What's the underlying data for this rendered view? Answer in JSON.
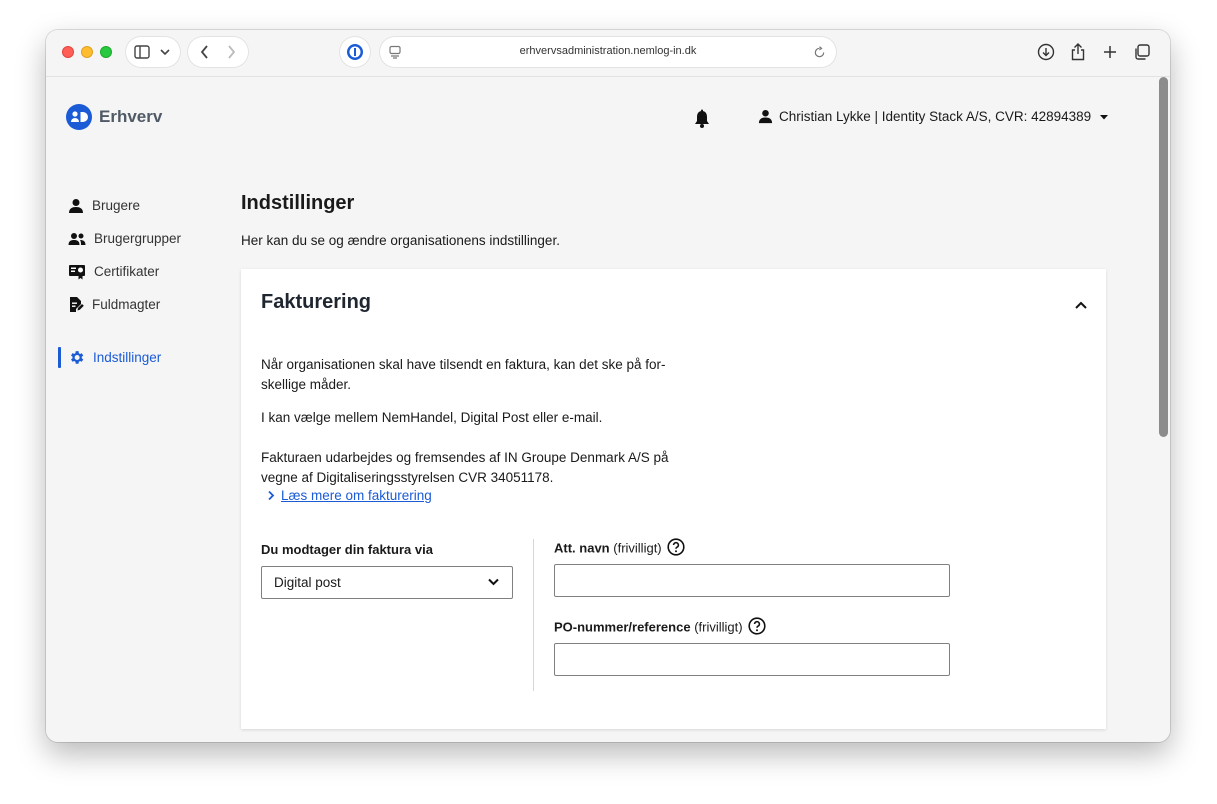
{
  "browser": {
    "url": "erhvervsadministration.nemlog-in.dk"
  },
  "brand": {
    "name": "Erhverv"
  },
  "header": {
    "user_label": "Christian Lykke | Identity Stack A/S, CVR: 42894389"
  },
  "sidebar": {
    "items": [
      {
        "label": "Brugere",
        "icon": "person-icon"
      },
      {
        "label": "Brugergrupper",
        "icon": "people-icon"
      },
      {
        "label": "Certifikater",
        "icon": "certificate-icon"
      },
      {
        "label": "Fuldmagter",
        "icon": "document-edit-icon"
      },
      {
        "label": "Indstillinger",
        "icon": "gear-icon",
        "active": true
      }
    ]
  },
  "main": {
    "title": "Indstillinger",
    "description": "Her kan du se og ændre organisationens indstillinger.",
    "card": {
      "title": "Fakturering",
      "para1": "Når organisationen skal have tilsendt en faktura, kan det ske på for-skellige måder.",
      "para2": "I kan vælge mellem NemHandel, Digital Post eller e-mail.",
      "para3": "Fakturaen udarbejdes og fremsendes af IN Groupe Denmark A/S på vegne af Digitaliseringsstyrelsen CVR 34051178.",
      "read_more": "Læs mere om fakturering",
      "delivery_label": "Du modtager din faktura via",
      "delivery_value": "Digital post",
      "att_label": "Att. navn",
      "att_optional": "(frivilligt)",
      "att_value": "",
      "po_label": "PO-nummer/reference",
      "po_optional": "(frivilligt)",
      "po_value": ""
    }
  },
  "colors": {
    "accent": "#1b5bd6",
    "background": "#f5f5f5",
    "card": "#ffffff"
  }
}
